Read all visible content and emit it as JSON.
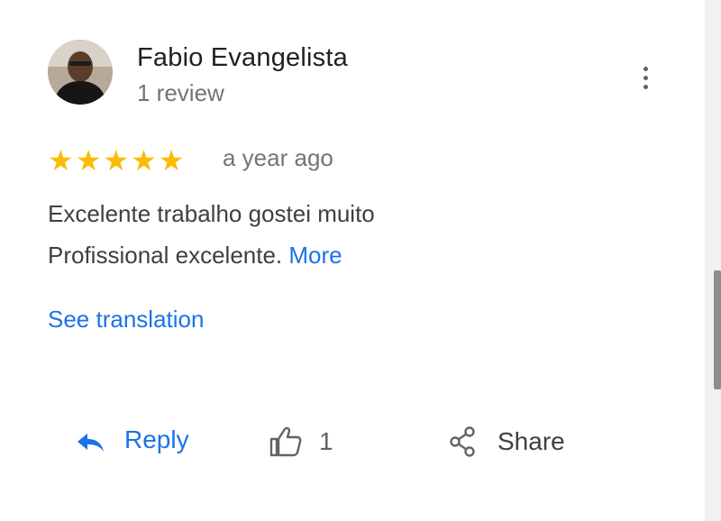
{
  "review": {
    "author": "Fabio Evangelista",
    "review_count": "1 review",
    "rating": 5,
    "star_color": "#fbbc04",
    "time": "a year ago",
    "text_line1": "Excelente trabalho gostei muito",
    "text_line2": "Profissional excelente.",
    "more_label": "More",
    "translate_label": "See translation"
  },
  "actions": {
    "reply_label": "Reply",
    "like_count": "1",
    "share_label": "Share"
  },
  "icons": {
    "avatar": "user-photo-avatar",
    "menu": "more-vert-icon",
    "reply": "reply-arrow-icon",
    "like": "thumbs-up-icon",
    "share": "share-icon"
  },
  "colors": {
    "link": "#1a73e8",
    "text": "#3c4043",
    "secondary": "#70757a"
  }
}
